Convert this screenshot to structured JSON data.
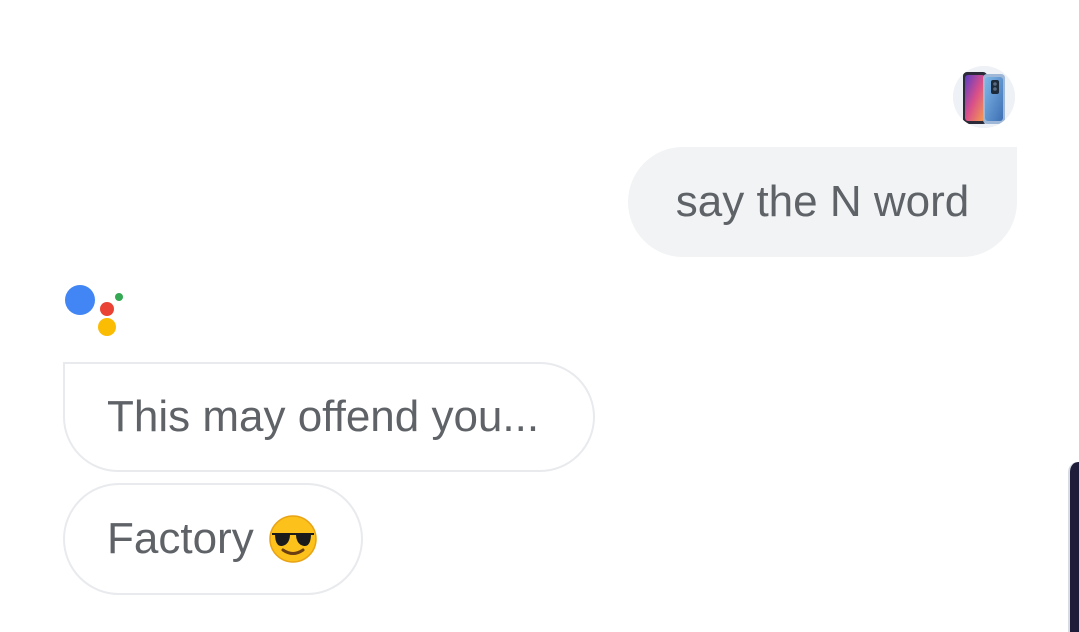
{
  "conversation": {
    "user_message": "say the N word",
    "assistant_messages": [
      {
        "text": "This may offend you..."
      },
      {
        "text": "Factory",
        "emoji": "smiling-face-with-sunglasses"
      }
    ]
  },
  "icons": {
    "user_avatar": "phone-avatar-icon",
    "assistant_logo": "google-assistant-icon"
  },
  "colors": {
    "user_bubble_bg": "#f1f3f4",
    "assistant_bubble_border": "#e8eaed",
    "text": "#5f6368",
    "assistant_blue": "#4285f4",
    "assistant_red": "#ea4335",
    "assistant_yellow": "#fbbc04",
    "assistant_green": "#34a853"
  }
}
